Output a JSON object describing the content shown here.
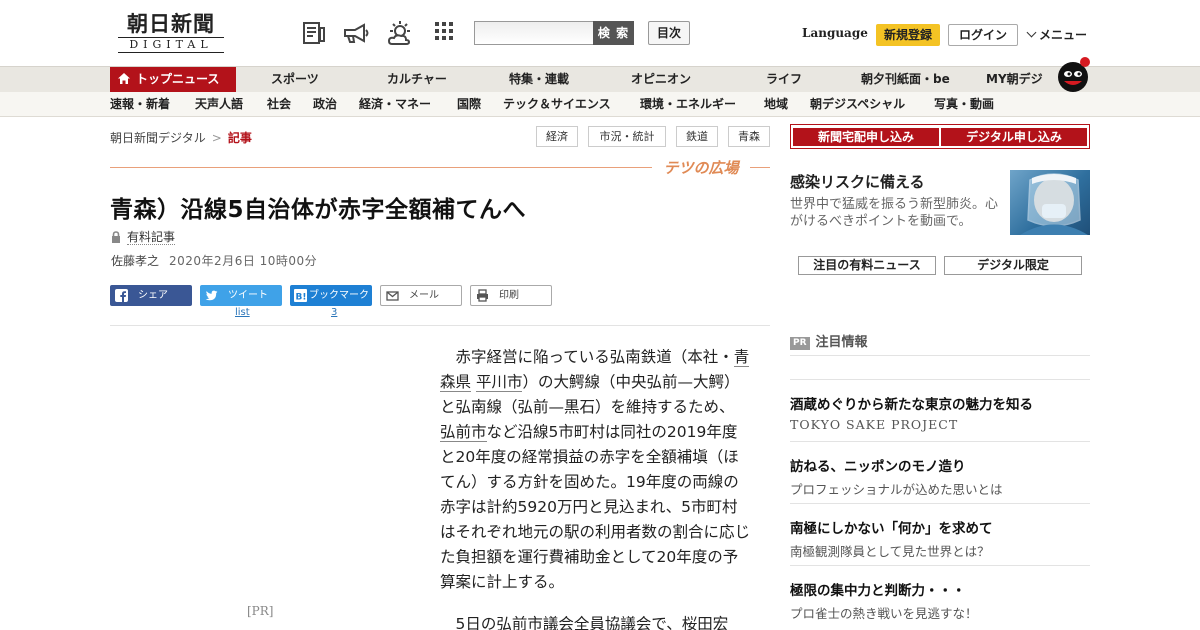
{
  "header": {
    "logo_jp": "朝日新聞",
    "logo_en": "DIGITAL",
    "search_button": "検 索",
    "toc_button": "目次",
    "language": "Language",
    "signup": "新規登録",
    "login": "ログイン",
    "menu": "メニュー",
    "icons": [
      "newspaper-icon",
      "megaphone-icon",
      "weather-icon",
      "apps-grid-icon"
    ]
  },
  "nav_main": {
    "top": "トップニュース",
    "items": [
      "スポーツ",
      "カルチャー",
      "特集・連載",
      "オピニオン",
      "ライフ",
      "朝夕刊紙面・be",
      "MY朝デジ"
    ]
  },
  "nav_sub": {
    "items": [
      "速報・新着",
      "天声人語",
      "社会",
      "政治",
      "経済・マネー",
      "国際",
      "テック＆サイエンス",
      "環境・エネルギー",
      "地域",
      "朝デジスペシャル",
      "写真・動画"
    ]
  },
  "breadcrumb": {
    "home": "朝日新聞デジタル",
    "sep": ">",
    "current": "記事"
  },
  "tags": [
    "経済",
    "市況・統計",
    "鉄道",
    "青森"
  ],
  "banner": "テツの広場",
  "article": {
    "title": "青森）沿線5自治体が赤字全額補てんへ",
    "paid_label": "有料記事",
    "author": "佐藤孝之",
    "date": "2020年2月6日 10時00分",
    "body_segments": [
      "赤字経営に陥っている弘南鉄道（本社・",
      "青森県",
      "平川市",
      "）の大鰐線（中央弘前—大鰐）と弘南線（弘前—黒石）を維持するため、",
      "弘前市",
      "など沿線5市町村は同社の2019年度と20年度の経常損益の赤字を全額補塡（ほてん）する方針を固めた。19年度の両線の赤字は計約5920万円と見込まれ、5市町村はそれぞれ地元の駅の利用者数の割合に応じた負担額を運行費補助金として20年度の予算案に計上する。"
    ],
    "body2": [
      "5日の",
      "弘前市",
      "議会全員協議会で、桜田宏"
    ],
    "pr_ad": "[PR]"
  },
  "share": {
    "facebook": "シェア",
    "twitter": "ツイート",
    "twitter_count": "list",
    "hatena": "ブックマーク",
    "hatena_count": "3",
    "mail": "メール",
    "print": "印刷"
  },
  "right": {
    "subscribe_paper": "新聞宅配申し込み",
    "subscribe_digital": "デジタル申し込み",
    "promo_title": "感染リスクに備える",
    "promo_desc": "世界中で猛威を振るう新型肺炎。心がけるべきポイントを動画で。",
    "tab_paid_news": "注目の有料ニュース",
    "tab_digital": "デジタル限定",
    "pr_badge": "PR",
    "pr_heading": "注目情報",
    "pr_items": [
      {
        "title": "酒蔵めぐりから新たな東京の魅力を知る",
        "sub": "TOKYO SAKE PROJECT"
      },
      {
        "title": "訪ねる、ニッポンのモノ造り",
        "sub": "プロフェッショナルが込めた思いとは"
      },
      {
        "title": "南極にしかない「何か」を求めて",
        "sub": "南極観測隊員として見た世界とは？"
      },
      {
        "title": "極限の集中力と判断力・・・",
        "sub": "プロ雀士の熱き戦いを見逃すな！"
      }
    ]
  },
  "colors": {
    "brand_red": "#b3121a",
    "signup_yellow": "#f4c324",
    "facebook": "#3a5795",
    "twitter": "#3fa2e8",
    "hatena": "#1e80d4"
  }
}
